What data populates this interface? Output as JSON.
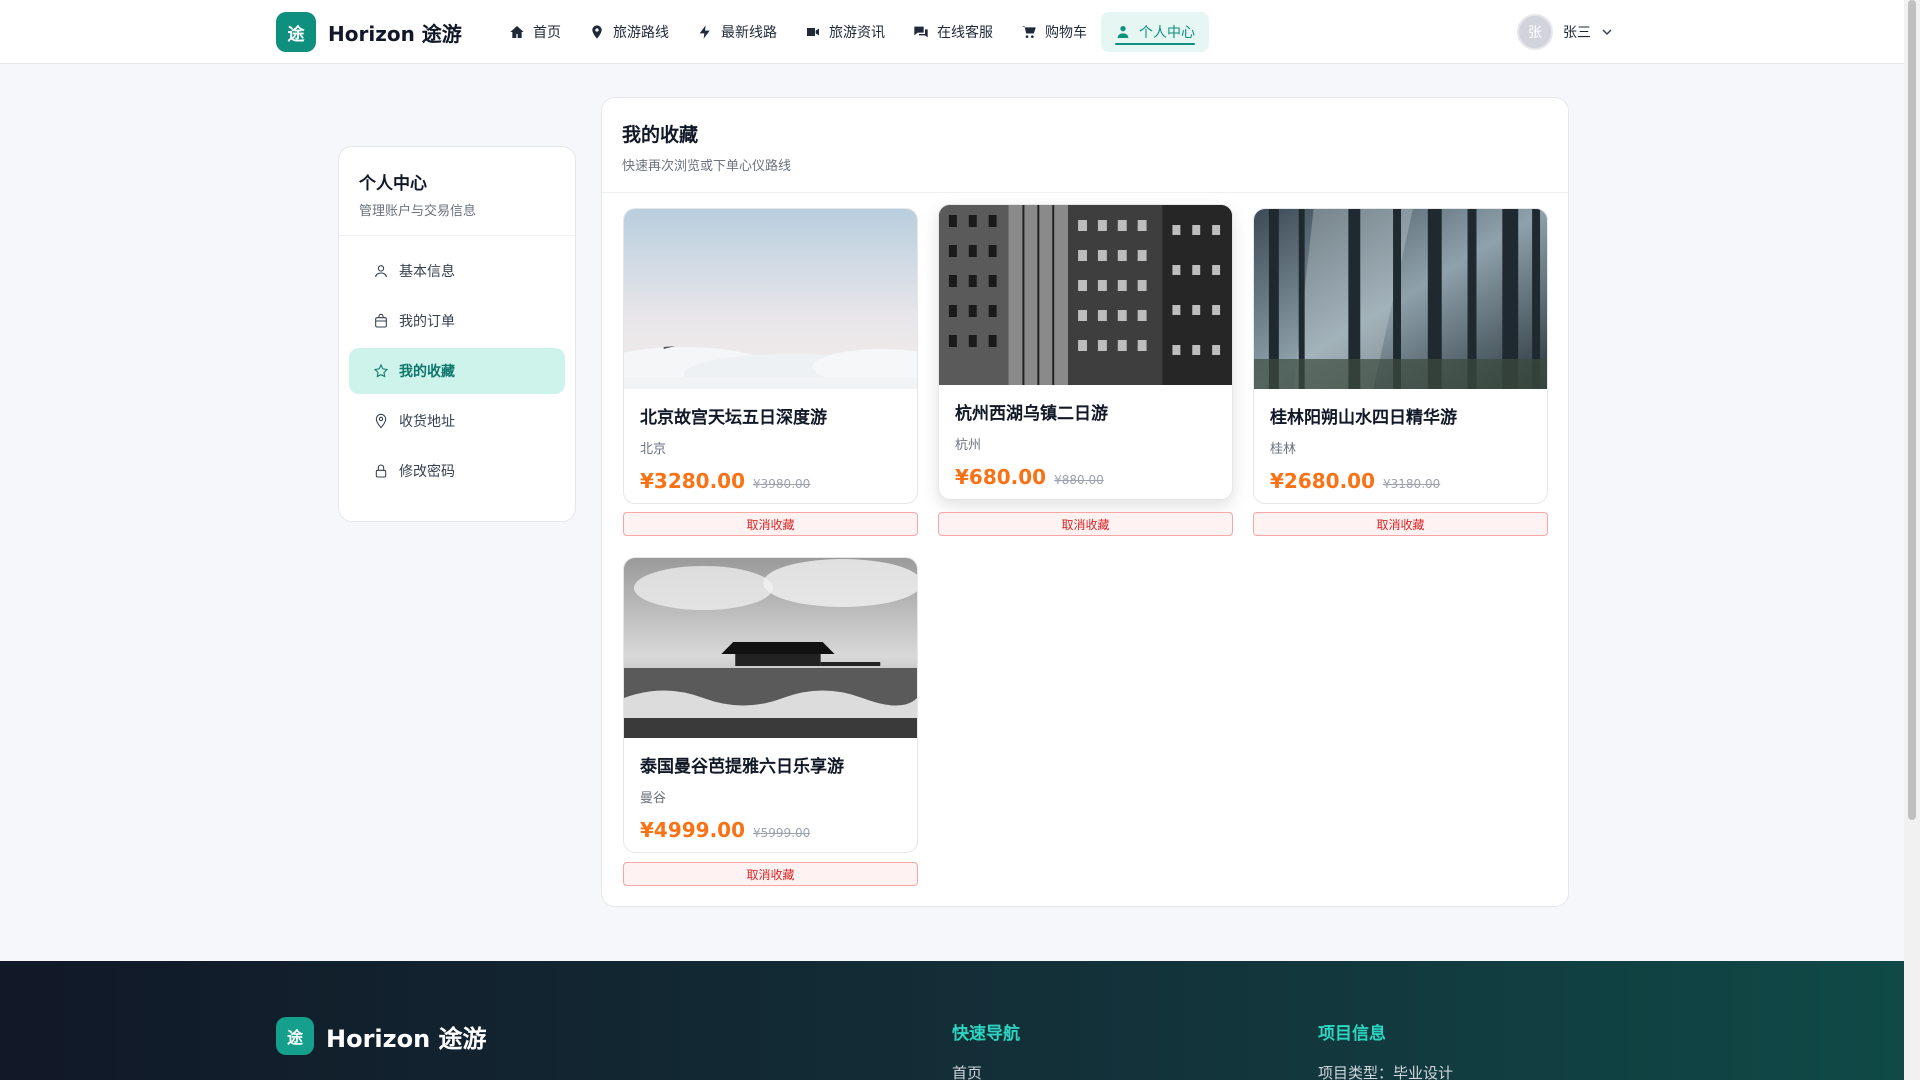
{
  "brand": {
    "logo_char": "途",
    "name": "Horizon 途游"
  },
  "nav": [
    {
      "label": "首页",
      "icon": "home-icon"
    },
    {
      "label": "旅游路线",
      "icon": "map-pin-icon"
    },
    {
      "label": "最新线路",
      "icon": "bolt-icon"
    },
    {
      "label": "旅游资讯",
      "icon": "video-icon"
    },
    {
      "label": "在线客服",
      "icon": "chat-icon"
    },
    {
      "label": "购物车",
      "icon": "cart-icon"
    },
    {
      "label": "个人中心",
      "icon": "user-icon",
      "active": true
    }
  ],
  "user": {
    "avatar_char": "张",
    "name": "张三"
  },
  "sidebar": {
    "title": "个人中心",
    "subtitle": "管理账户与交易信息",
    "items": [
      {
        "label": "基本信息",
        "icon": "user-outline-icon"
      },
      {
        "label": "我的订单",
        "icon": "bag-icon"
      },
      {
        "label": "我的收藏",
        "icon": "star-icon",
        "active": true
      },
      {
        "label": "收货地址",
        "icon": "location-icon"
      },
      {
        "label": "修改密码",
        "icon": "lock-icon"
      }
    ]
  },
  "favorites": {
    "title": "我的收藏",
    "subtitle": "快速再次浏览或下单心仪路线",
    "unfav_label": "取消收藏",
    "items": [
      {
        "title": "北京故宫天坛五日深度游",
        "city": "北京",
        "price": "¥3280.00",
        "old_price": "¥3980.00"
      },
      {
        "title": "杭州西湖乌镇二日游",
        "city": "杭州",
        "price": "¥680.00",
        "old_price": "¥880.00"
      },
      {
        "title": "桂林阳朔山水四日精华游",
        "city": "桂林",
        "price": "¥2680.00",
        "old_price": "¥3180.00"
      },
      {
        "title": "泰国曼谷芭提雅六日乐享游",
        "city": "曼谷",
        "price": "¥4999.00",
        "old_price": "¥5999.00"
      }
    ]
  },
  "footer": {
    "brand_name": "Horizon 途游",
    "quick_nav_title": "快速导航",
    "quick_nav_first": "首页",
    "project_title": "项目信息",
    "project_first": "项目类型：毕业设计"
  },
  "colors": {
    "accent": "#0f8f7e",
    "price": "#f97316",
    "danger": "#dc2626"
  }
}
